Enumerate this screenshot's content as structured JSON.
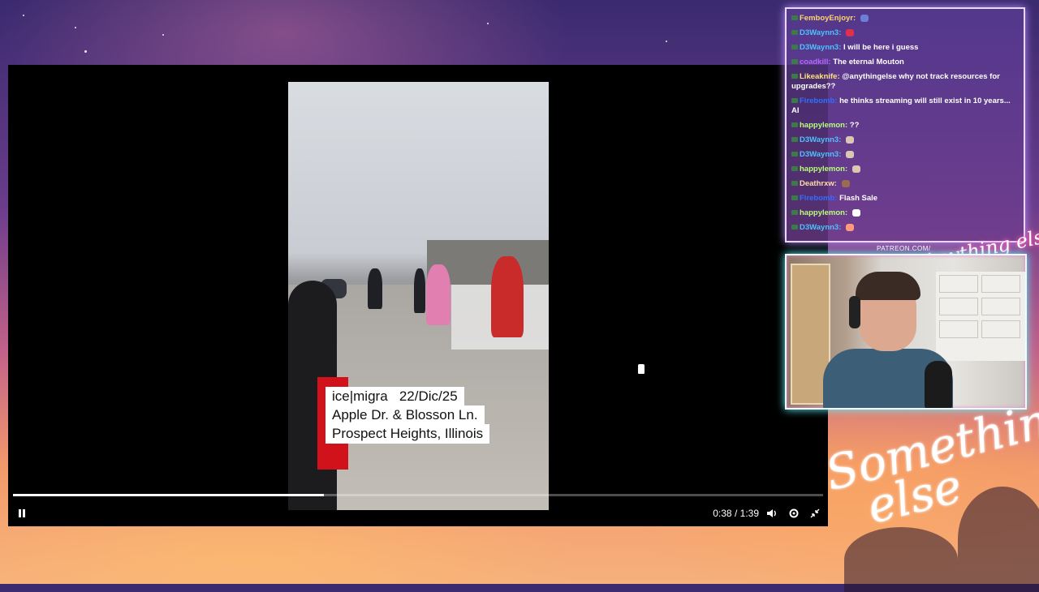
{
  "player": {
    "time_current": "0:38",
    "time_separator": "/",
    "time_total": "1:39",
    "progress_fraction": 0.384,
    "play_state": "playing",
    "caption_lines": [
      "ice|migra   22/Dic/25",
      "Apple Dr. & Blosson Ln.",
      "Prospect Heights, Illinois"
    ],
    "icons": {
      "pause": "pause-icon",
      "volume": "volume-icon",
      "settings": "gear-icon",
      "exit_fullscreen": "exit-fullscreen-icon"
    }
  },
  "chat": {
    "messages": [
      {
        "user": "FemboyEnjoyr",
        "user_color": "#ffd66b",
        "text": "",
        "emote": "#6d7dd8"
      },
      {
        "user": "D3Waynn3",
        "user_color": "#4cc3ff",
        "text": "",
        "emote": "#e0304a"
      },
      {
        "user": "D3Waynn3",
        "user_color": "#4cc3ff",
        "text": "I will be here i guess",
        "emote": ""
      },
      {
        "user": "coadkill",
        "user_color": "#b466ff",
        "text": "The eternal Mouton",
        "emote": ""
      },
      {
        "user": "Likeaknife",
        "user_color": "#ffe27a",
        "text": "@anythingelse why not track resources for upgrades??",
        "emote": ""
      },
      {
        "user": "Firebomb",
        "user_color": "#2f6fff",
        "text": "he thinks streaming will still exist in 10 years... AI",
        "emote": ""
      },
      {
        "user": "happylemon",
        "user_color": "#b8ff7a",
        "text": "??",
        "emote": ""
      },
      {
        "user": "D3Waynn3",
        "user_color": "#4cc3ff",
        "text": "",
        "emote": "#d9c7b3"
      },
      {
        "user": "D3Waynn3",
        "user_color": "#4cc3ff",
        "text": "",
        "emote": "#d9c7b3"
      },
      {
        "user": "happylemon",
        "user_color": "#b8ff7a",
        "text": "",
        "emote": "#d9c7b3"
      },
      {
        "user": "Deathrxw",
        "user_color": "#ffdfa8",
        "text": "",
        "emote": "#9a6b4f"
      },
      {
        "user": "Firebomb",
        "user_color": "#2f6fff",
        "text": "Flash Sale",
        "emote": ""
      },
      {
        "user": "happylemon",
        "user_color": "#b8ff7a",
        "text": "",
        "emote": "#ffffff"
      },
      {
        "user": "D3Waynn3",
        "user_color": "#4cc3ff",
        "text": "",
        "emote": "#ff9a7a"
      }
    ]
  },
  "overlay": {
    "patreon_text": "PATREON.COM/",
    "logo_small": "Anything else",
    "logo_large_line1": "Something",
    "logo_large_line2": "else"
  },
  "colors": {
    "chat_border": "#e9d9ff",
    "webcam_border": "#e9ffff",
    "caption_red": "#d1121b"
  }
}
